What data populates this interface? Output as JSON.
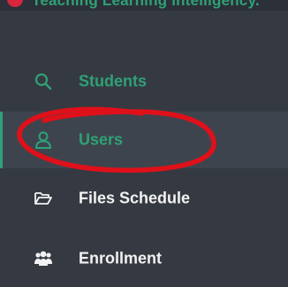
{
  "header": {
    "title": "Teaching Learning Intelligency."
  },
  "sidebar": {
    "items": [
      {
        "label": "Students",
        "icon": "search-icon",
        "state": "highlighted"
      },
      {
        "label": "Users",
        "icon": "user-icon",
        "state": "active"
      },
      {
        "label": "Files Schedule",
        "icon": "folder-open-icon",
        "state": "normal"
      },
      {
        "label": "Enrollment",
        "icon": "users-group-icon",
        "state": "normal"
      }
    ]
  },
  "colors": {
    "sidebar_bg": "#353a42",
    "active_bg": "#3e444d",
    "accent_green": "#2fa176",
    "annotation_red": "#e0101a",
    "text_white": "#f2f2f2"
  }
}
